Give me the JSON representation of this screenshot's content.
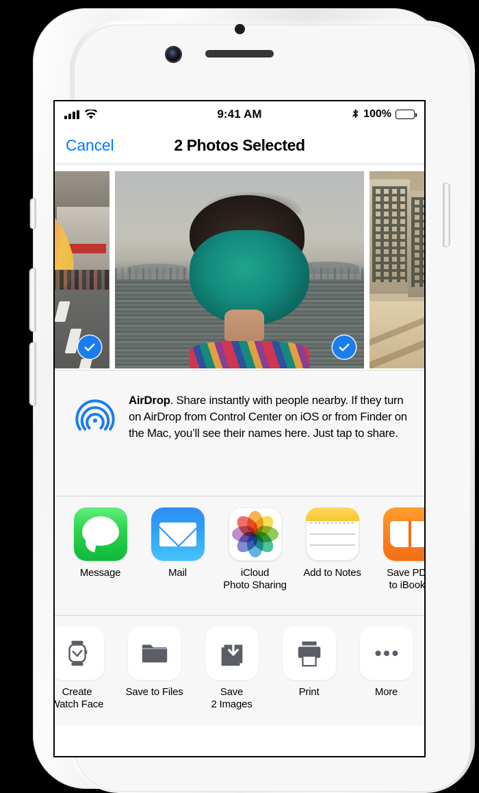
{
  "device": {
    "name": "iPhone",
    "hardware": [
      "proximity-sensor",
      "front-camera",
      "earpiece-speaker",
      "mute-switch",
      "volume-up-button",
      "volume-down-button",
      "power-button"
    ]
  },
  "status_bar": {
    "signal_bars": 4,
    "signal_icon": "cellular-signal-icon",
    "wifi_icon": "wifi-icon",
    "time": "9:41 AM",
    "bluetooth_icon": "bluetooth-icon",
    "battery_percent": "100%",
    "battery_icon": "battery-full-icon",
    "battery_level": 100
  },
  "nav_bar": {
    "cancel_label": "Cancel",
    "title": "2 Photos Selected"
  },
  "photo_strip": {
    "photos": [
      {
        "name": "street-scene-photo",
        "alt": "Street scene with red banner and road",
        "selected": true,
        "badge": "check-filled"
      },
      {
        "name": "teal-hair-photo",
        "alt": "Person with teal hair facing the water",
        "selected": true,
        "badge": "check-filled"
      },
      {
        "name": "buildings-photo",
        "alt": "Weathered buildings behind a wall",
        "selected": false,
        "badge": "check-empty"
      }
    ]
  },
  "airdrop": {
    "icon": "airdrop-icon",
    "title": "AirDrop",
    "body": ". Share instantly with people nearby. If they turn on AirDrop from Control Center on iOS or from Finder on the Mac, you’ll see their names here. Just tap to share."
  },
  "app_row": {
    "items": [
      {
        "name": "share-message",
        "label": "Message",
        "icon": "messages-app-icon",
        "color": "#2fd14e"
      },
      {
        "name": "share-mail",
        "label": "Mail",
        "icon": "mail-app-icon",
        "color": "#2f9ef7"
      },
      {
        "name": "share-icloud-photo-sharing",
        "label": "iCloud\nPhoto Sharing",
        "icon": "photos-app-icon",
        "color": "#ffffff"
      },
      {
        "name": "share-add-to-notes",
        "label": "Add to Notes",
        "icon": "notes-app-icon",
        "color": "#f6c72f"
      },
      {
        "name": "share-save-pdf-to-ibooks",
        "label": "Save PDF\nto iBooks",
        "icon": "ibooks-app-icon",
        "color": "#fb8020"
      }
    ]
  },
  "action_row": {
    "items": [
      {
        "name": "action-create-watch-face",
        "label": "Create\nWatch Face",
        "icon": "apple-watch-icon"
      },
      {
        "name": "action-save-to-files",
        "label": "Save to Files",
        "icon": "folder-icon"
      },
      {
        "name": "action-save-images",
        "label": "Save\n2 Images",
        "icon": "save-download-icon"
      },
      {
        "name": "action-print",
        "label": "Print",
        "icon": "printer-icon"
      },
      {
        "name": "action-more",
        "label": "More",
        "icon": "ellipsis-icon"
      }
    ]
  },
  "colors": {
    "accent_blue": "#007aff",
    "check_blue": "#1a7ded",
    "airdrop_blue": "#1a7ded",
    "sheet_background": "#f7f7f7",
    "separator": "#d4d4d4",
    "icon_gray": "#5b5e66"
  }
}
